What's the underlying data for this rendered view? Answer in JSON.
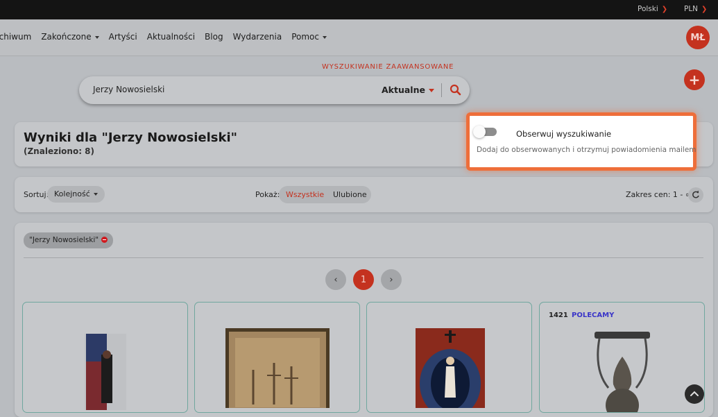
{
  "topbar": {
    "language": "Polski",
    "currency": "PLN"
  },
  "nav": {
    "items": [
      {
        "label": "rchiwum",
        "dropdown": false
      },
      {
        "label": "Zakończone",
        "dropdown": true
      },
      {
        "label": "Artyści",
        "dropdown": false
      },
      {
        "label": "Aktualności",
        "dropdown": false
      },
      {
        "label": "Blog",
        "dropdown": false
      },
      {
        "label": "Wydarzenia",
        "dropdown": false
      },
      {
        "label": "Pomoc",
        "dropdown": true
      }
    ],
    "avatar_initials": "MŁ"
  },
  "search": {
    "advanced_label": "WYSZUKIWANIE ZAAWANSOWANE",
    "query": "Jerzy Nowosielski",
    "scope": "Aktualne"
  },
  "results": {
    "title": "Wyniki dla \"Jerzy Nowosielski\"",
    "count_text": "(Znaleziono: 8)"
  },
  "watch": {
    "title": "Obserwuj wyszukiwanie",
    "description": "Dodaj do obserwowanych i otrzymuj powiadomienia mailem",
    "enabled": false
  },
  "filters": {
    "sort_label": "Sortuj:",
    "sort_value": "Kolejność",
    "show_label": "Pokaż:",
    "show_options": [
      "Wszystkie",
      "Ulubione"
    ],
    "price_range": "Zakres cen: 1 - ∞"
  },
  "active_tag": "\"Jerzy Nowosielski\"",
  "pagination": {
    "current": "1",
    "prev": "‹",
    "next": "›"
  },
  "items": [
    {
      "id": "",
      "badge": ""
    },
    {
      "id": "",
      "badge": ""
    },
    {
      "id": "",
      "badge": ""
    },
    {
      "id": "1421",
      "badge": "POLECAMY"
    }
  ],
  "colors": {
    "accent": "#c4321f",
    "highlight": "#ee6e3a",
    "badge": "#3a35c8"
  }
}
